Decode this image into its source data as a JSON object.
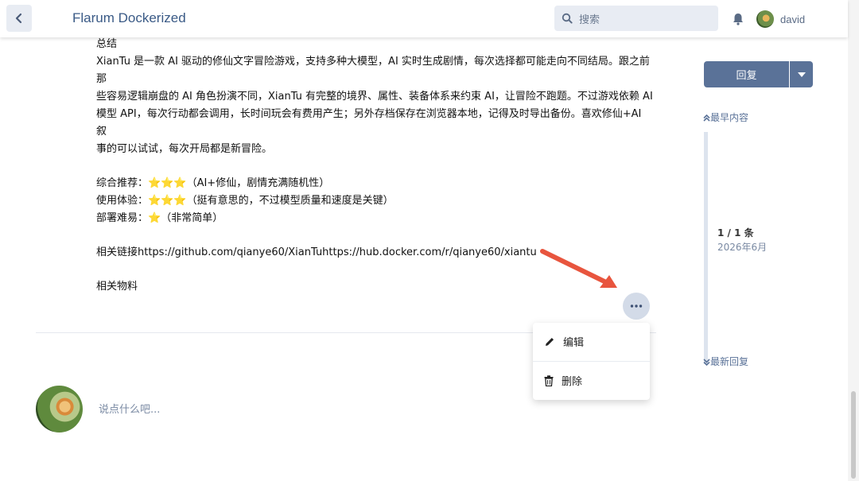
{
  "header": {
    "title": "Flarum Dockerized",
    "search_placeholder": "搜索",
    "username": "david"
  },
  "post": {
    "lines": [
      "总结",
      "XianTu 是一款 AI 驱动的修仙文字冒险游戏，支持多种大模型，AI 实时生成剧情，每次选择都可能走向不同结局。跟之前那",
      "些容易逻辑崩盘的 AI 角色扮演不同，XianTu 有完整的境界、属性、装备体系来约束 AI，让冒险不跑题。不过游戏依赖 AI",
      "模型 API，每次行动都会调用，长时间玩会有费用产生；另外存档保存在浏览器本地，记得及时导出备份。喜欢修仙+AI 叙",
      "事的可以试试，每次开局都是新冒险。"
    ],
    "ratings": [
      {
        "label": "综合推荐：",
        "stars": "⭐⭐⭐",
        "note": "（AI+修仙，剧情充满随机性）"
      },
      {
        "label": "使用体验：",
        "stars": "⭐⭐⭐",
        "note": "（挺有意思的，不过模型质量和速度是关键）"
      },
      {
        "label": "部署难易：",
        "stars": "⭐",
        "note": "（非常简单）"
      }
    ],
    "links_line": "相关链接https://github.com/qianye60/XianTuhttps://hub.docker.com/r/qianye60/xiantu",
    "materials": "相关物料"
  },
  "dropdown": {
    "edit": "编辑",
    "delete": "删除"
  },
  "composer": {
    "placeholder": "说点什么吧..."
  },
  "sidebar": {
    "reply_label": "回复",
    "earliest": "最早内容",
    "count": "1 / 1 条",
    "date": "2026年6月",
    "latest": "最新回复"
  },
  "colors": {
    "accent": "#5a7298",
    "title": "#3a5a86",
    "arrow": "#e8553e"
  }
}
